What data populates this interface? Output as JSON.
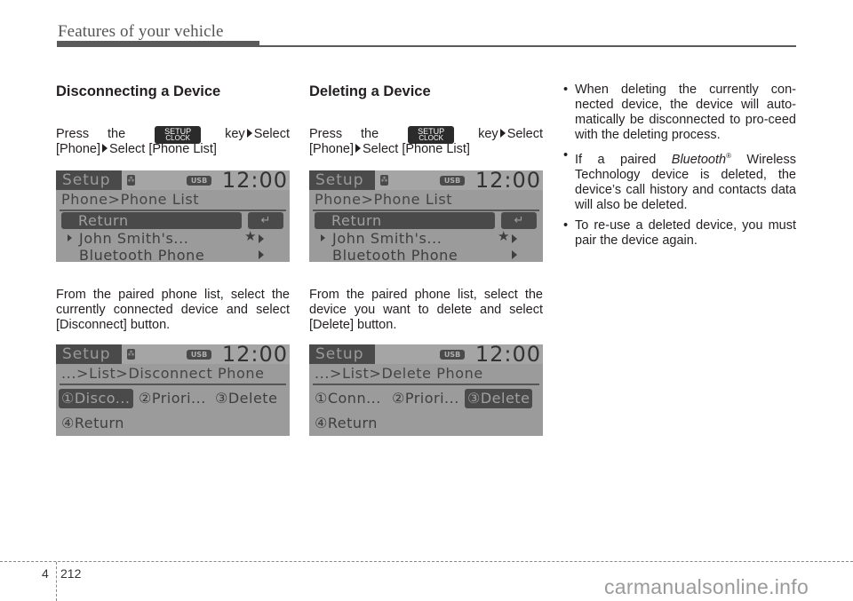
{
  "header": {
    "title": "Features of your vehicle"
  },
  "key_label": {
    "line1": "SETUP",
    "line2": "CLOCK"
  },
  "sections": [
    {
      "title": "Disconnecting a Device",
      "press": {
        "word1": "Press",
        "word2": "the",
        "key": "key",
        "select1": "Select",
        "phone": "[Phone]",
        "select2": "Select [Phone List]"
      },
      "screen1": {
        "tab": "Setup",
        "bt_icon": "bluetooth-icon",
        "usb": "USB",
        "clock": "12:00",
        "crumb": "Phone>Phone List",
        "rows": [
          "Return",
          "John Smith's...",
          "Bluetooth Phone"
        ],
        "return_icon": "↵",
        "star": "★"
      },
      "paragraph": "From the paired phone list, select the currently connected device and select  [Disconnect] button.",
      "screen2": {
        "tab": "Setup",
        "usb": "USB",
        "clock": "12:00",
        "crumb": "...>List>Disconnect Phone",
        "options": [
          "①Disco...",
          "②Priori...",
          "③Delete",
          "④Return"
        ],
        "selected_index": 0
      }
    },
    {
      "title": "Deleting a Device",
      "press": {
        "word1": "Press",
        "word2": "the",
        "key": "key",
        "select1": "Select",
        "phone": "[Phone]",
        "select2": "Select [Phone List]"
      },
      "screen1": {
        "tab": "Setup",
        "bt_icon": "bluetooth-icon",
        "usb": "USB",
        "clock": "12:00",
        "crumb": "Phone>Phone List",
        "rows": [
          "Return",
          "John Smith's...",
          "Bluetooth Phone"
        ],
        "return_icon": "↵",
        "star": "★"
      },
      "paragraph": "From the paired phone list, select the device you want to delete and select [Delete] button.",
      "screen2": {
        "tab": "Setup",
        "usb": "USB",
        "clock": "12:00",
        "crumb": "...>List>Delete Phone",
        "options": [
          "①Conn...",
          "②Priori...",
          "③Delete",
          "④Return"
        ],
        "selected_index": 2
      }
    }
  ],
  "notes": [
    {
      "text": "When deleting the currently con-nected device, the device will auto-matically be disconnected to pro-ceed with the deleting process."
    },
    {
      "pre": "If a paired ",
      "italic": "Bluetooth",
      "sup": "®",
      "post": " Wireless Technology device is deleted, the device’s call history and contacts data will also be deleted."
    },
    {
      "text": "To re-use a deleted device, you must pair the device again."
    }
  ],
  "footer": {
    "chapter": "4",
    "page": "212",
    "watermark": "carmanualsonline.info"
  }
}
